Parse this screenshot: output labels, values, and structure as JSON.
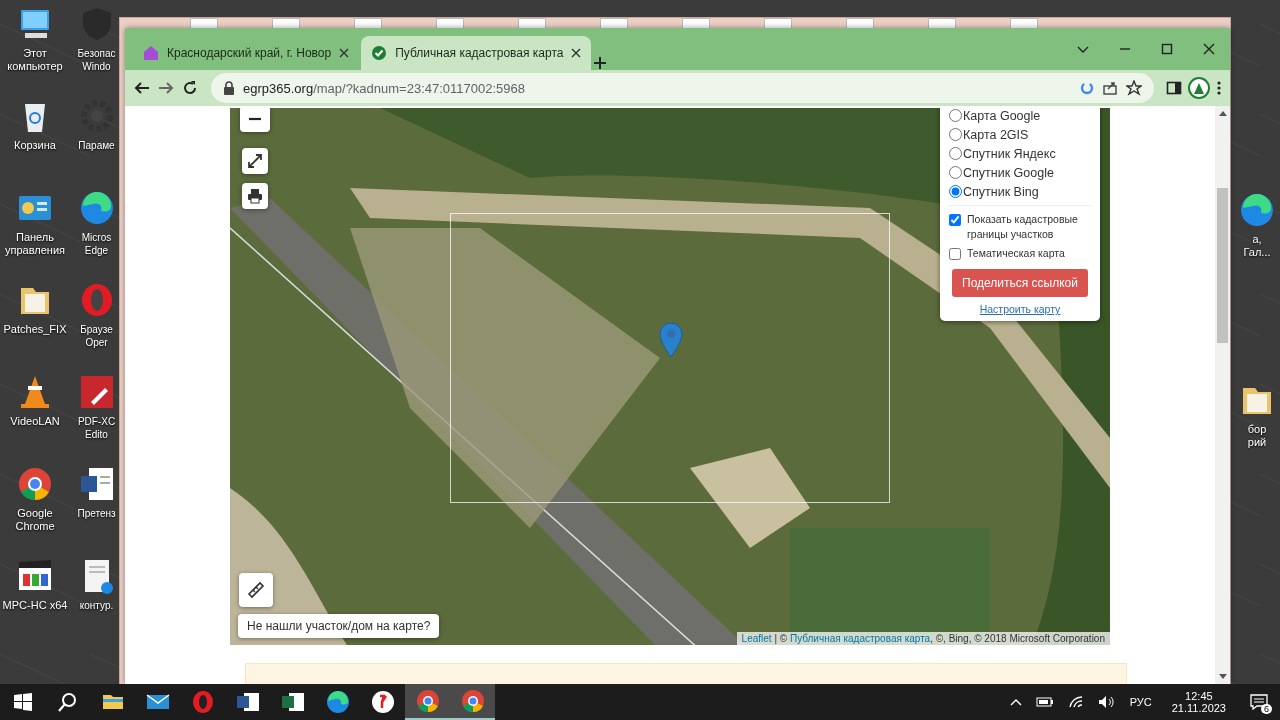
{
  "desktop": {
    "left_column": [
      {
        "kind": "computer",
        "lines": [
          "Этот",
          "компьютер"
        ]
      },
      {
        "kind": "recycle",
        "lines": [
          "Корзина"
        ]
      },
      {
        "kind": "panel",
        "lines": [
          "Панель",
          "управления"
        ]
      },
      {
        "kind": "folder",
        "lines": [
          "Patches_FIX"
        ]
      },
      {
        "kind": "cone",
        "lines": [
          "VideoLAN"
        ]
      },
      {
        "kind": "chrome",
        "lines": [
          "Google",
          "Chrome"
        ]
      },
      {
        "kind": "clapper",
        "lines": [
          "MPC-HC x64"
        ]
      }
    ],
    "second_column": [
      {
        "kind": "shield",
        "lines": [
          "Безопас",
          "Windo"
        ]
      },
      {
        "kind": "gear",
        "lines": [
          "Параме"
        ]
      },
      {
        "kind": "edge",
        "lines": [
          "Micros",
          "Edge"
        ]
      },
      {
        "kind": "opera",
        "lines": [
          "Браузе",
          "Oper"
        ]
      },
      {
        "kind": "pdf",
        "lines": [
          "PDF-XC",
          "Edito"
        ]
      },
      {
        "kind": "word",
        "lines": [
          "Претенз"
        ]
      },
      {
        "kind": "page",
        "lines": [
          "контур."
        ]
      }
    ],
    "right_column": [
      {
        "kind": "edge",
        "lines": [
          "а,",
          "Гал..."
        ]
      },
      {
        "kind": "folder",
        "lines": [
          "бор",
          "рий"
        ]
      }
    ]
  },
  "browser": {
    "tabs": [
      {
        "kind": "house",
        "title": "Краснодарский край, г. Новор",
        "selected": false
      },
      {
        "kind": "check",
        "title": "Публичная кадастровая карта",
        "selected": true
      }
    ],
    "address": {
      "domain": "egrp365.org",
      "path": "/map/?kadnum=23:47:0117002:5968"
    }
  },
  "map": {
    "layers": [
      {
        "label": "Карта Google",
        "selected": false
      },
      {
        "label": "Карта 2GIS",
        "selected": false
      },
      {
        "label": "Спутник Яндекс",
        "selected": false
      },
      {
        "label": "Спутник Google",
        "selected": false
      },
      {
        "label": "Спутник Bing",
        "selected": true
      }
    ],
    "options": [
      {
        "label": "Показать кадастровые границы участков",
        "checked": true
      },
      {
        "label": "Тематическая карта",
        "checked": false
      }
    ],
    "share_button": "Поделиться ссылкой",
    "settings_link": "Настроить карту",
    "not_found_button": "Не нашли участок/дом на карте?",
    "attribution": {
      "leaflet": "Leaflet",
      "separator": "| ©",
      "source": "Публичная кадастровая карта",
      "rest": ", ©, Bing, © 2018 Microsoft Corporation"
    }
  },
  "taskbar": {
    "apps": [
      {
        "kind": "explorer",
        "active": false
      },
      {
        "kind": "mail",
        "active": false
      },
      {
        "kind": "opera",
        "active": false
      },
      {
        "kind": "word",
        "active": false
      },
      {
        "kind": "excel",
        "active": false
      },
      {
        "kind": "edge",
        "active": false
      },
      {
        "kind": "yandex",
        "active": false
      },
      {
        "kind": "chrome",
        "active": true
      },
      {
        "kind": "chrome",
        "active": true
      }
    ],
    "language": "РУС",
    "time": "12:45",
    "date": "21.11.2023",
    "notifications": "6"
  }
}
